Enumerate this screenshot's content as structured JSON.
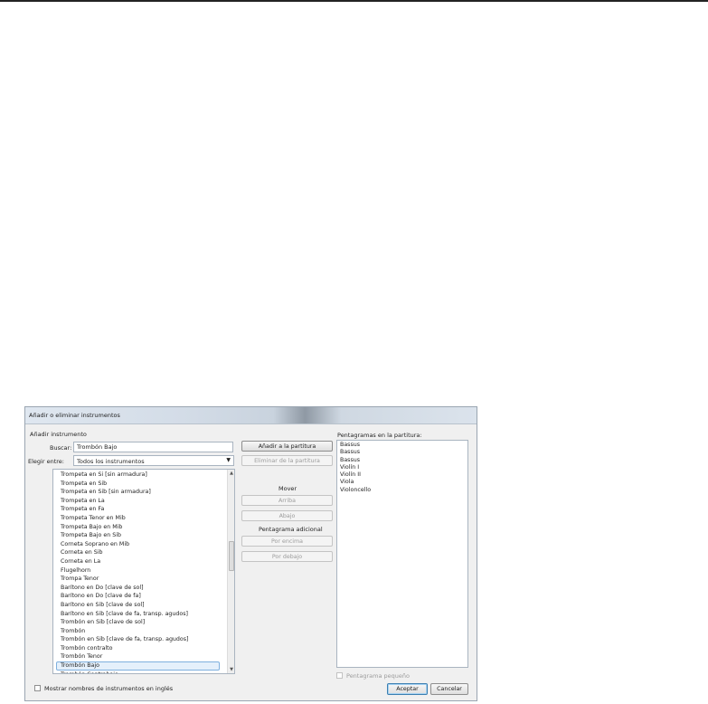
{
  "dialog": {
    "title": "Añadir o eliminar instrumentos"
  },
  "left": {
    "section_label": "Añadir instrumento",
    "search_label": "Buscar:",
    "search_value": "Trombón Bajo",
    "choose_label": "Elegir entre:",
    "choose_value": "Todos los instrumentos",
    "instruments": [
      "Trompeta en Si [sin armadura]",
      "Trompeta en Sib",
      "Trompeta en Sib [sin armadura]",
      "Trompeta en La",
      "Trompeta en Fa",
      "Trompeta Tenor en Mib",
      "Trompeta Bajo en Mib",
      "Trompeta Bajo en Sib",
      "Corneta Soprano en Mib",
      "Corneta en Sib",
      "Corneta en La",
      "Flugelhorn",
      "Trompa Tenor",
      "Barítono en Do [clave de sol]",
      "Barítono en Do [clave de fa]",
      "Barítono en Sib [clave de sol]",
      "Barítono en Sib [clave de fa, transp. agudos]",
      "Trombón en Sib [clave de sol]",
      "Trombón",
      "Trombón en Sib [clave de fa, transp. agudos]",
      "Trombón contralto",
      "Trombón Tenor",
      "Trombón Bajo",
      "Trombón Contrabajo"
    ],
    "selected_index": 22,
    "english_names_label": "Mostrar nombres de instrumentos en inglés"
  },
  "middle": {
    "add_label": "Añadir a la partitura",
    "remove_label": "Eliminar de la partitura",
    "move_heading": "Mover",
    "up_label": "Arriba",
    "down_label": "Abajo",
    "extra_staff_heading": "Pentagrama adicional",
    "above_label": "Por encima",
    "below_label": "Por debajo"
  },
  "right": {
    "staves_label": "Pentagramas en la partitura:",
    "staves": [
      "Bassus",
      "Bassus",
      "Bassus",
      "Violín I",
      "Violín II",
      "Viola",
      "Violoncello"
    ],
    "small_staff_label": "Pentagrama pequeño"
  },
  "footer": {
    "ok_label": "Aceptar",
    "cancel_label": "Cancelar"
  },
  "icons": {
    "dropdown": "chevron-down-icon",
    "scroll_up": "arrow-up-icon",
    "scroll_down": "arrow-down-icon"
  },
  "colors": {
    "selection_fill": "#e5f0fb",
    "selection_border": "#7fb0de",
    "primary_border": "#3c7fb1"
  }
}
